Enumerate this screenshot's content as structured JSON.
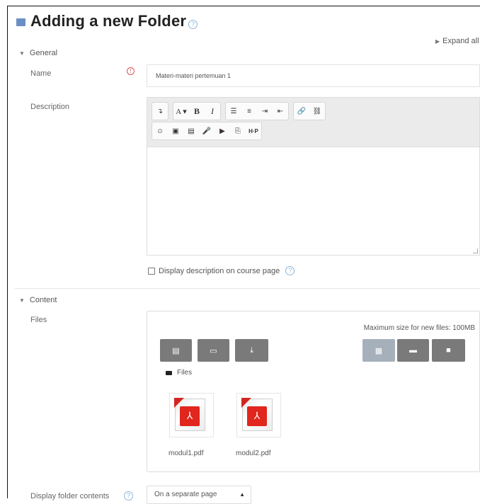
{
  "page": {
    "title": "Adding a new Folder",
    "expand_all": "Expand all"
  },
  "general": {
    "header": "General",
    "name_label": "Name",
    "name_value": "Materi-materi pertemuan 1",
    "description_label": "Description",
    "toolbar_row1": [
      {
        "name": "toggle-toolbar-button",
        "glyph": "↴"
      },
      {
        "name": "font-family-button",
        "glyph": "A ▾"
      },
      {
        "name": "bold-button",
        "glyph": "B"
      },
      {
        "name": "italic-button",
        "glyph": "I"
      },
      {
        "name": "unordered-list-button",
        "glyph": "☰"
      },
      {
        "name": "ordered-list-button",
        "glyph": "≡"
      },
      {
        "name": "indent-button",
        "glyph": "⇥"
      },
      {
        "name": "outdent-button",
        "glyph": "⇤"
      },
      {
        "name": "link-button",
        "glyph": "🔗"
      },
      {
        "name": "unlink-button",
        "glyph": "⛓"
      }
    ],
    "toolbar_row2": [
      {
        "name": "emoticon-button",
        "glyph": "☺"
      },
      {
        "name": "image-button",
        "glyph": "▣"
      },
      {
        "name": "media-button",
        "glyph": "▤"
      },
      {
        "name": "record-audio-button",
        "glyph": "🎤"
      },
      {
        "name": "record-video-button",
        "glyph": "▶"
      },
      {
        "name": "manage-files-button",
        "glyph": "⎘"
      },
      {
        "name": "h5p-button",
        "glyph": "H·P"
      }
    ],
    "display_description_label": "Display description on course page"
  },
  "content": {
    "header": "Content",
    "files_label": "Files",
    "max_size": "Maximum size for new files: 100MB",
    "path_label": "Files",
    "files": [
      {
        "name": "modul1.pdf"
      },
      {
        "name": "modul2.pdf"
      }
    ],
    "display_folder_label": "Display folder contents",
    "display_folder_value": "On a separate page"
  },
  "colors": {
    "accent": "#6b8fc4",
    "required": "#d9534f",
    "file_button": "#7a7a7a",
    "file_button_active": "#a5b0bb",
    "pdf_red": "#e0261d"
  },
  "icons": {
    "title": "folder-icon",
    "add_file": "file-icon",
    "create_folder": "folder-open-icon",
    "download": "download-icon",
    "view_grid": "grid-icon",
    "view_list": "list-icon",
    "view_tree": "folder-icon"
  }
}
